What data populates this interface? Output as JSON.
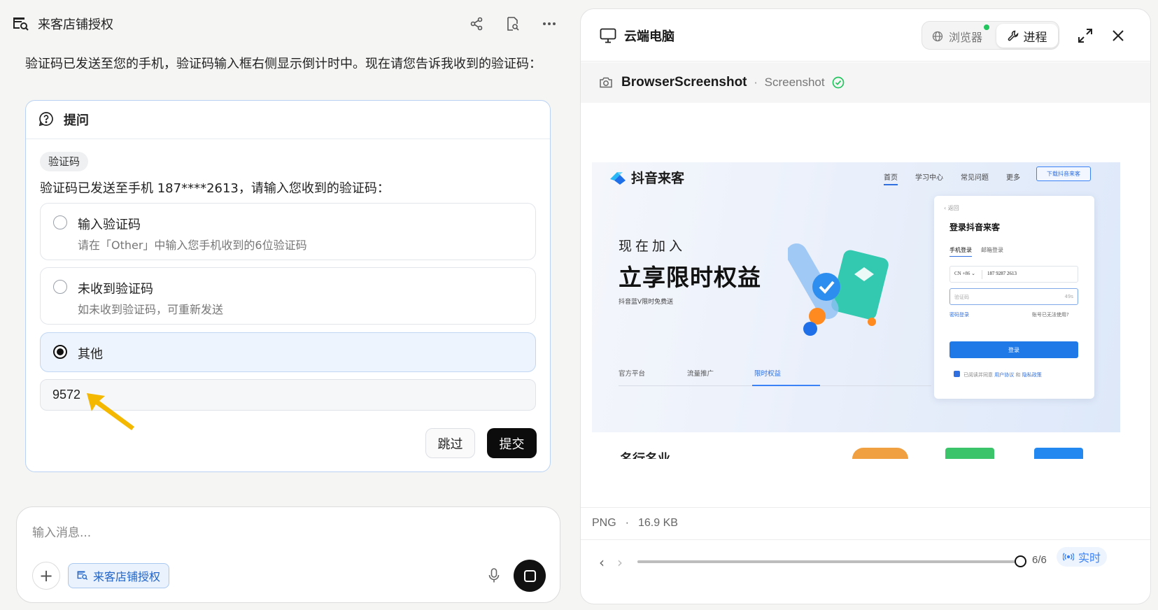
{
  "chat": {
    "header_title": "来客店铺授权",
    "message": "验证码已发送至您的手机，验证码输入框右侧显示倒计时中。现在请您告诉我收到的验证码：",
    "card": {
      "header_label": "提问",
      "tag": "验证码",
      "question": "验证码已发送至手机 187****2613，请输入您收到的验证码：",
      "options": [
        {
          "title": "输入验证码",
          "desc": "请在「Other」中输入您手机收到的6位验证码",
          "selected": false
        },
        {
          "title": "未收到验证码",
          "desc": "如未收到验证码，可重新发送",
          "selected": false
        },
        {
          "title": "其他",
          "desc": "",
          "selected": true
        }
      ],
      "other_value": "9572",
      "skip_label": "跳过",
      "submit_label": "提交"
    },
    "composer": {
      "placeholder": "输入消息...",
      "chip_label": "来客店铺授权"
    }
  },
  "cloud": {
    "title": "云端电脑",
    "seg_browser": "浏览器",
    "seg_process": "进程",
    "tool_name": "BrowserScreenshot",
    "tool_sub": "Screenshot",
    "file_type": "PNG",
    "file_size": "16.9 KB",
    "step_count": "6/6",
    "step_progress": 1.0,
    "live_label": "实时",
    "screenshot": {
      "logo": "抖音来客",
      "nav": [
        "首页",
        "学习中心",
        "常见问题",
        "更多"
      ],
      "download_btn": "下载抖音来客",
      "hero_line1": "现在加入",
      "hero_line2": "立享限时权益",
      "hero_line3": "抖音蓝V限时免费送",
      "tabs": [
        "官方平台",
        "流量推广",
        "限时权益"
      ],
      "login": {
        "back": "返回",
        "title": "登录抖音来客",
        "tab_phone": "手机登录",
        "tab_email": "邮箱登录",
        "country_code": "CN +86",
        "phone": "187 9287 2613",
        "code_placeholder": "验证码",
        "countdown": "49s",
        "pwd_login": "密码登录",
        "no_use": "账号已无法使用?",
        "login_btn": "登录",
        "agree_prefix": "已阅读并同意",
        "agree_link1": "用户协议",
        "agree_and": "和",
        "agree_link2": "隐私政策"
      },
      "bottom_title": "名行名业"
    }
  },
  "colors": {
    "accent_blue": "#3b82f6",
    "card_border": "#b9d2f3",
    "status_green": "#22c55e",
    "arrow_yellow": "#f5b800"
  }
}
